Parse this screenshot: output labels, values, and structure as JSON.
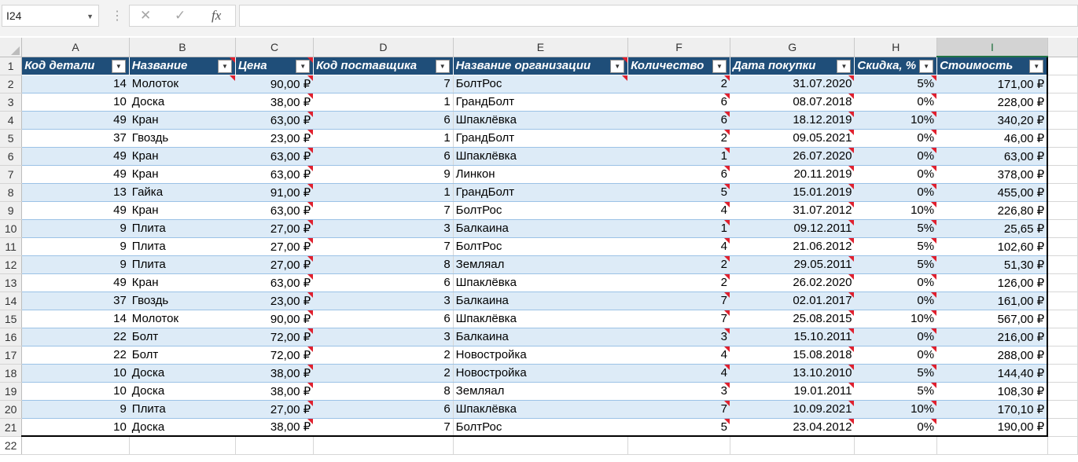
{
  "namebox": {
    "value": "I24",
    "dropdown_icon": "chevron-down-icon"
  },
  "formula_bar": {
    "cancel_icon": "close-icon",
    "enter_icon": "check-icon",
    "fx_label": "fx",
    "formula": ""
  },
  "columns": [
    "A",
    "B",
    "C",
    "D",
    "E",
    "F",
    "G",
    "H",
    "I"
  ],
  "selected_column": "I",
  "headers": [
    "Код детали",
    "Название",
    "Цена",
    "Код поставщика",
    "Название организации",
    "Количество",
    "Дата покупки",
    "Скидка, %",
    "Стоимость"
  ],
  "rows": [
    {
      "n": "2",
      "cells": [
        "14",
        "Молоток",
        "90,00 ₽",
        "7",
        "БолтРос",
        "2",
        "31.07.2020",
        "5%",
        "171,00 ₽"
      ]
    },
    {
      "n": "3",
      "cells": [
        "10",
        "Доска",
        "38,00 ₽",
        "1",
        "ГрандБолт",
        "6",
        "08.07.2018",
        "0%",
        "228,00 ₽"
      ]
    },
    {
      "n": "4",
      "cells": [
        "49",
        "Кран",
        "63,00 ₽",
        "6",
        "Шпаклёвка",
        "6",
        "18.12.2019",
        "10%",
        "340,20 ₽"
      ]
    },
    {
      "n": "5",
      "cells": [
        "37",
        "Гвоздь",
        "23,00 ₽",
        "1",
        "ГрандБолт",
        "2",
        "09.05.2021",
        "0%",
        "46,00 ₽"
      ]
    },
    {
      "n": "6",
      "cells": [
        "49",
        "Кран",
        "63,00 ₽",
        "6",
        "Шпаклёвка",
        "1",
        "26.07.2020",
        "0%",
        "63,00 ₽"
      ]
    },
    {
      "n": "7",
      "cells": [
        "49",
        "Кран",
        "63,00 ₽",
        "9",
        "Линкон",
        "6",
        "20.11.2019",
        "0%",
        "378,00 ₽"
      ]
    },
    {
      "n": "8",
      "cells": [
        "13",
        "Гайка",
        "91,00 ₽",
        "1",
        "ГрандБолт",
        "5",
        "15.01.2019",
        "0%",
        "455,00 ₽"
      ]
    },
    {
      "n": "9",
      "cells": [
        "49",
        "Кран",
        "63,00 ₽",
        "7",
        "БолтРос",
        "4",
        "31.07.2012",
        "10%",
        "226,80 ₽"
      ]
    },
    {
      "n": "10",
      "cells": [
        "9",
        "Плита",
        "27,00 ₽",
        "3",
        "Балкаина",
        "1",
        "09.12.2011",
        "5%",
        "25,65 ₽"
      ]
    },
    {
      "n": "11",
      "cells": [
        "9",
        "Плита",
        "27,00 ₽",
        "7",
        "БолтРос",
        "4",
        "21.06.2012",
        "5%",
        "102,60 ₽"
      ]
    },
    {
      "n": "12",
      "cells": [
        "9",
        "Плита",
        "27,00 ₽",
        "8",
        "Земляал",
        "2",
        "29.05.2011",
        "5%",
        "51,30 ₽"
      ]
    },
    {
      "n": "13",
      "cells": [
        "49",
        "Кран",
        "63,00 ₽",
        "6",
        "Шпаклёвка",
        "2",
        "26.02.2020",
        "0%",
        "126,00 ₽"
      ]
    },
    {
      "n": "14",
      "cells": [
        "37",
        "Гвоздь",
        "23,00 ₽",
        "3",
        "Балкаина",
        "7",
        "02.01.2017",
        "0%",
        "161,00 ₽"
      ]
    },
    {
      "n": "15",
      "cells": [
        "14",
        "Молоток",
        "90,00 ₽",
        "6",
        "Шпаклёвка",
        "7",
        "25.08.2015",
        "10%",
        "567,00 ₽"
      ]
    },
    {
      "n": "16",
      "cells": [
        "22",
        "Болт",
        "72,00 ₽",
        "3",
        "Балкаина",
        "3",
        "15.10.2011",
        "0%",
        "216,00 ₽"
      ]
    },
    {
      "n": "17",
      "cells": [
        "22",
        "Болт",
        "72,00 ₽",
        "2",
        "Новостройка",
        "4",
        "15.08.2018",
        "0%",
        "288,00 ₽"
      ]
    },
    {
      "n": "18",
      "cells": [
        "10",
        "Доска",
        "38,00 ₽",
        "2",
        "Новостройка",
        "4",
        "13.10.2010",
        "5%",
        "144,40 ₽"
      ]
    },
    {
      "n": "19",
      "cells": [
        "10",
        "Доска",
        "38,00 ₽",
        "8",
        "Земляал",
        "3",
        "19.01.2011",
        "5%",
        "108,30 ₽"
      ]
    },
    {
      "n": "20",
      "cells": [
        "9",
        "Плита",
        "27,00 ₽",
        "6",
        "Шпаклёвка",
        "7",
        "10.09.2021",
        "10%",
        "170,10 ₽"
      ]
    },
    {
      "n": "21",
      "cells": [
        "10",
        "Доска",
        "38,00 ₽",
        "7",
        "БолтРос",
        "5",
        "23.04.2012",
        "0%",
        "190,00 ₽"
      ]
    }
  ],
  "empty_row_number": "22",
  "filter_icon": "filter-dropdown-icon",
  "comment_indicator_icon": "comment-indicator-icon",
  "colors": {
    "header_fill": "#1f4e79",
    "band_fill": "#ddebf7",
    "comment_marker": "#e0202e"
  }
}
